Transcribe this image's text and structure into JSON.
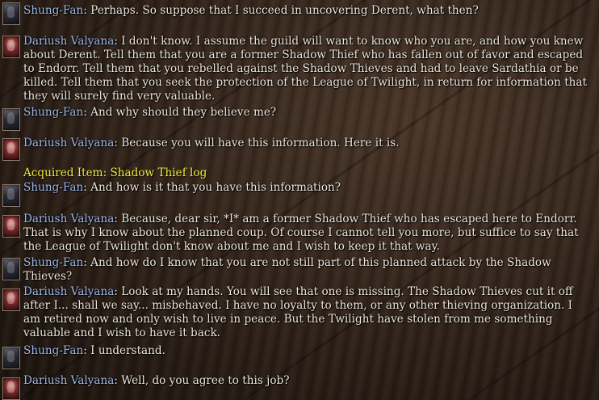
{
  "dialogue": [
    {
      "speaker": "Shung-Fan",
      "text": "Perhaps. So suppose that I succeed in uncovering Derent, what then?"
    },
    {
      "speaker": "Dariush Valyana",
      "text": "I don't know. I assume the guild will want to know who you are, and how you knew about Derent. Tell them that you are a former Shadow Thief who has fallen out of favor and escaped to Endorr. Tell them that you rebelled against the Shadow Thieves and had to leave Sardathia or be killed. Tell them that you seek the protection of the League of Twilight, in return for information that they will surely find very valuable."
    },
    {
      "speaker": "Shung-Fan",
      "text": "And why should they believe me?"
    },
    {
      "speaker": "Dariush Valyana",
      "text": "Because you will have this information. Here it is."
    },
    {
      "speaker": "Shung-Fan",
      "text": "And how is it that you have this information?"
    },
    {
      "speaker": "Dariush Valyana",
      "text": "Because, dear sir, *I* am a former Shadow Thief who has escaped here to Endorr. That is why I know about the planned coup. Of course I cannot tell you more, but suffice to say that the League of Twilight don't know about me and I wish to keep it that way."
    },
    {
      "speaker": "Shung-Fan",
      "text": "And how do I know that you are not still part of this planned attack by the Shadow Thieves?"
    },
    {
      "speaker": "Dariush Valyana",
      "text": "Look at my hands. You will see that one is missing. The Shadow Thieves cut it off after I... shall we say... misbehaved. I have no loyalty to them, or any other thieving organization. I am retired now and only wish to live in peace. But the Twilight have stolen from me something valuable and I wish to have it back."
    },
    {
      "speaker": "Shung-Fan",
      "text": "I understand."
    },
    {
      "speaker": "Dariush Valyana",
      "text": "Well, do you agree to this job?"
    }
  ],
  "acquired": "Acquired Item: Shadow Thief log",
  "colors": {
    "speaker": "#9fb8e8",
    "text": "#ece6da",
    "acquired": "#f2ea3a"
  }
}
